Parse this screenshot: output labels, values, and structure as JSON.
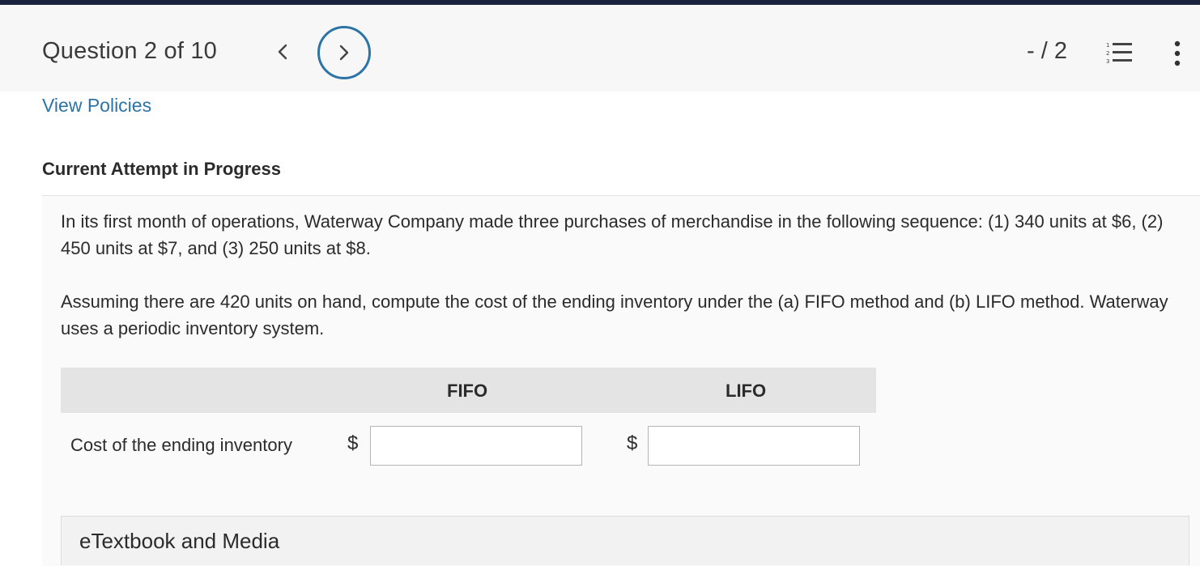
{
  "header": {
    "question_label": "Question 2 of 10",
    "score": "- / 2",
    "prev_icon": "chevron-left-icon",
    "next_icon": "chevron-right-icon",
    "list_icon": "numbered-list-icon",
    "more_icon": "more-vertical-icon"
  },
  "links": {
    "view_policies": "View Policies"
  },
  "attempt_heading": "Current Attempt in Progress",
  "question": {
    "paragraph1": "In its first month of operations, Waterway Company made three purchases of merchandise in the following sequence: (1) 340 units at $6, (2) 450 units at $7, and (3) 250 units at $8.",
    "paragraph2": "Assuming there are 420 units on hand, compute the cost of the ending inventory under the (a) FIFO method and (b) LIFO method. Waterway uses a periodic inventory system."
  },
  "answer_table": {
    "headers": [
      "FIFO",
      "LIFO"
    ],
    "row_label": "Cost of the ending inventory",
    "currency": "$",
    "fifo_value": "",
    "lifo_value": ""
  },
  "etextbook": {
    "label": "eTextbook and Media"
  },
  "colors": {
    "accent": "#2d74a6",
    "top_bar": "#1b2240",
    "header_bg": "#f7f7f7",
    "table_header_bg": "#e4e4e4"
  }
}
